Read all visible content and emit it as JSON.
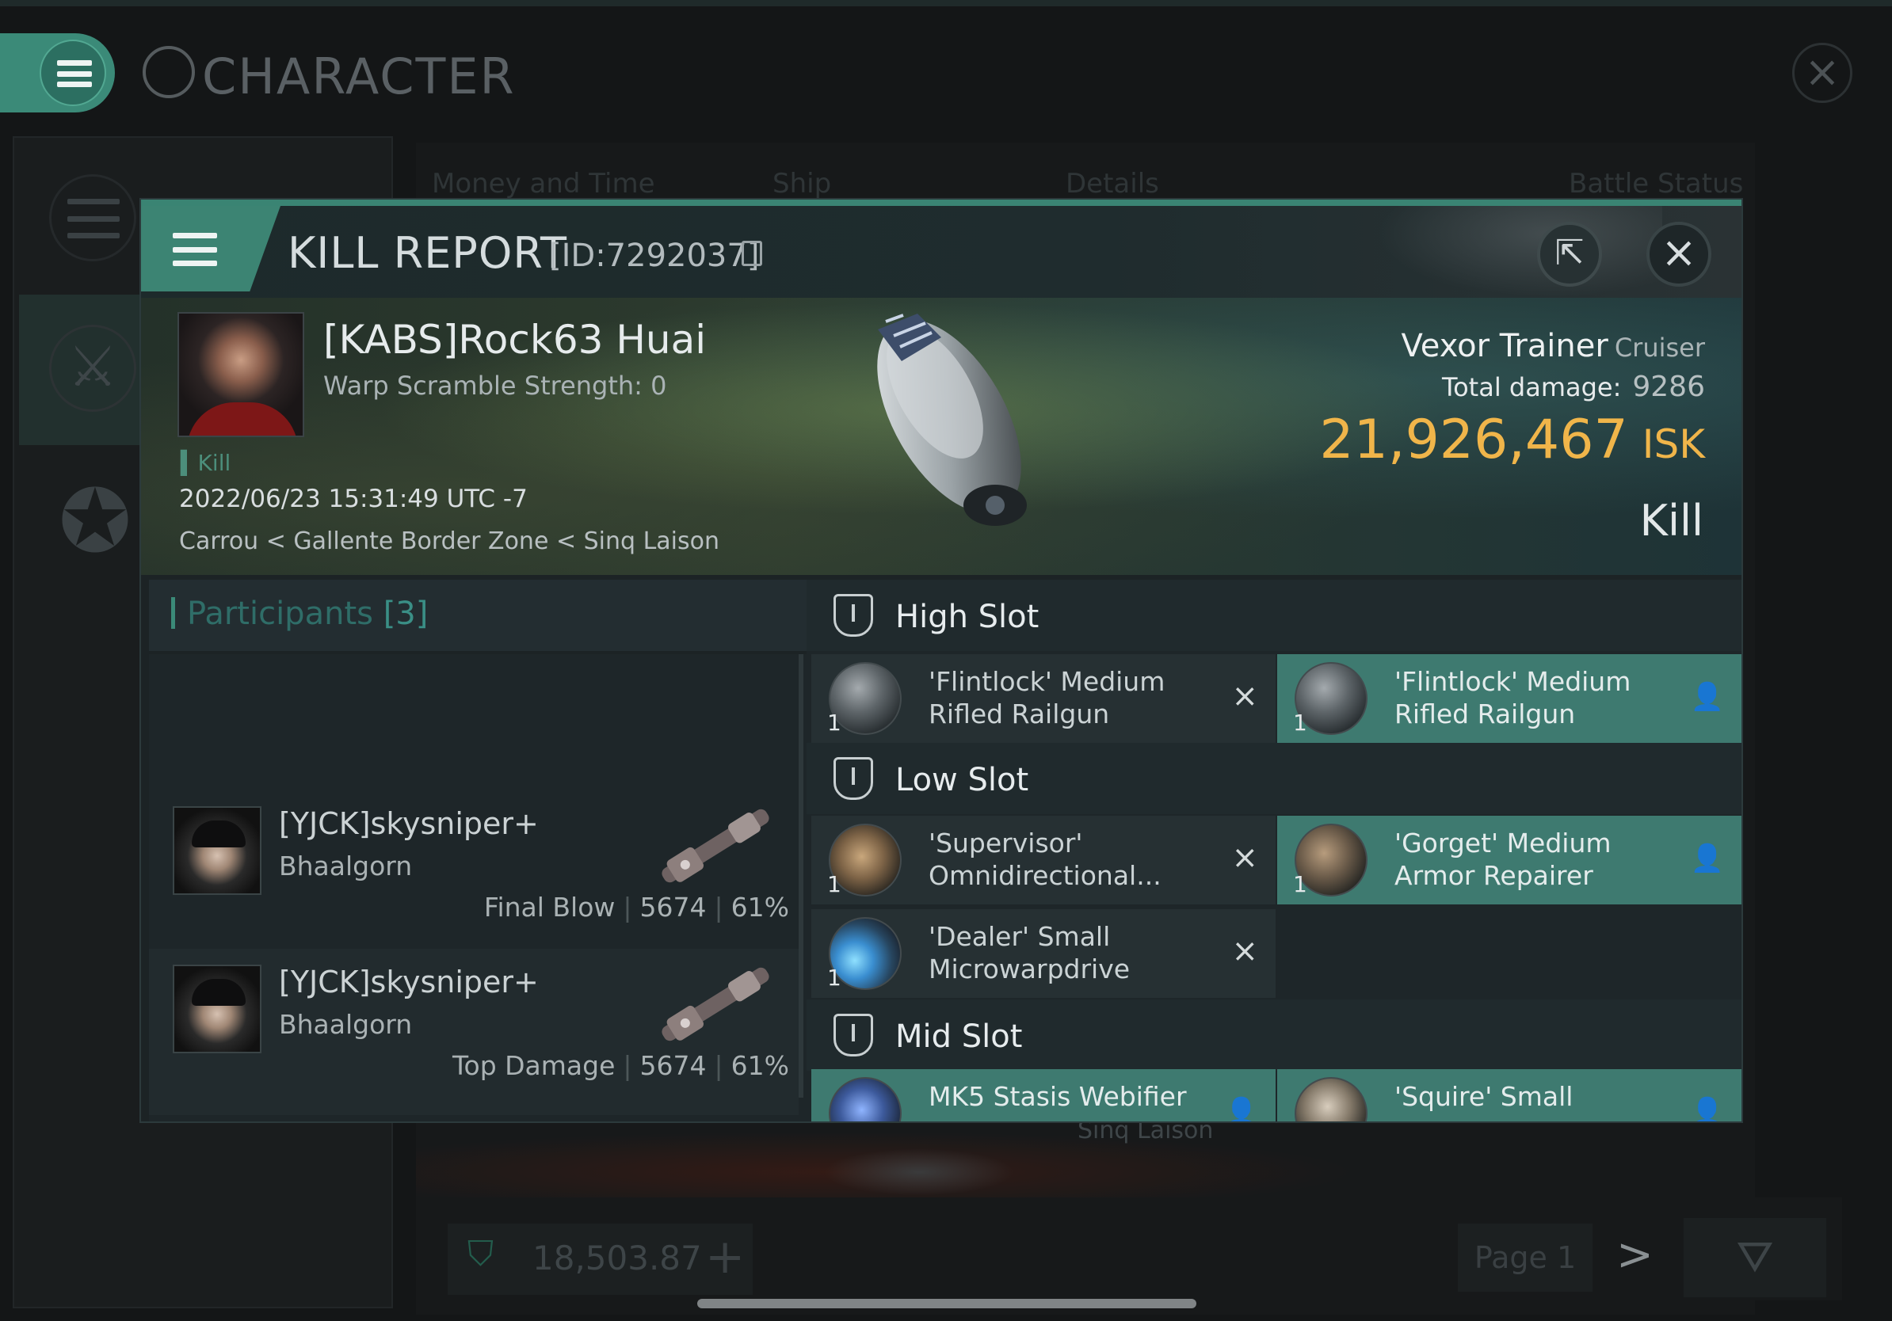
{
  "background_window": {
    "title": "CHARACTER",
    "tabs": [
      "Money and Time",
      "Ship",
      "Details",
      "Battle Status"
    ],
    "footer": {
      "balance": "18,503.87",
      "page": "Page 1"
    },
    "location_snippet": "Sinq Laison"
  },
  "kill_report": {
    "title": "KILL REPORT",
    "id": "[ID:7292037]",
    "victim": {
      "name": "[KABS]Rock63 Huai",
      "warp_scramble": "Warp Scramble Strength: 0",
      "tag": "Kill",
      "date": "2022/06/23 15:31:49 UTC -7",
      "location": "Carrou < Gallente Border Zone < Sinq Laison"
    },
    "ship": {
      "name": "Vexor Trainer",
      "class": "Cruiser",
      "total_damage_label": "Total damage:",
      "total_damage": "9286",
      "isk_value": "21,926,467",
      "isk_unit": "ISK",
      "status": "Kill"
    },
    "participants": {
      "label": "Participants",
      "count": "[3]",
      "items": [
        {
          "name": "[YJCK]skysniper+",
          "ship": "Bhaalgorn",
          "role": "Final Blow",
          "damage": "5674",
          "percent": "61%"
        },
        {
          "name": "[YJCK]skysniper+",
          "ship": "Bhaalgorn",
          "role": "Top Damage",
          "damage": "5674",
          "percent": "61%"
        }
      ]
    },
    "fitting": {
      "high_slot": {
        "label": "High Slot",
        "modules": [
          {
            "name": "'Flintlock' Medium Rifled Railgun",
            "qty": "1",
            "state": "destroyed",
            "icon": "railgun-icon",
            "status_icon": "×"
          },
          {
            "name": "'Flintlock' Medium Rifled Railgun",
            "qty": "1",
            "state": "dropped",
            "icon": "railgun-icon",
            "status_icon": "👤"
          }
        ]
      },
      "low_slot": {
        "label": "Low Slot",
        "modules": [
          {
            "name": "'Supervisor' Omnidirectional...",
            "qty": "1",
            "state": "destroyed",
            "icon": "tracking-link-icon",
            "status_icon": "×"
          },
          {
            "name": "'Gorget' Medium Armor Repairer",
            "qty": "1",
            "state": "dropped",
            "icon": "armor-repairer-icon",
            "status_icon": "👤"
          },
          {
            "name": "'Dealer' Small Microwarpdrive",
            "qty": "1",
            "state": "destroyed",
            "icon": "microwarpdrive-icon",
            "status_icon": "×"
          }
        ]
      },
      "mid_slot": {
        "label": "Mid Slot",
        "modules": [
          {
            "name": "MK5 Stasis Webifier",
            "state": "dropped",
            "icon": "stasis-webifier-icon",
            "status_icon": "👤"
          },
          {
            "name": "'Squire' Small",
            "state": "dropped",
            "icon": "capacitor-icon",
            "status_icon": "👤"
          }
        ]
      }
    }
  },
  "colors": {
    "accent": "#3b8a78",
    "isk": "#f0b54a",
    "dropped_bg": "#3e7a70"
  }
}
